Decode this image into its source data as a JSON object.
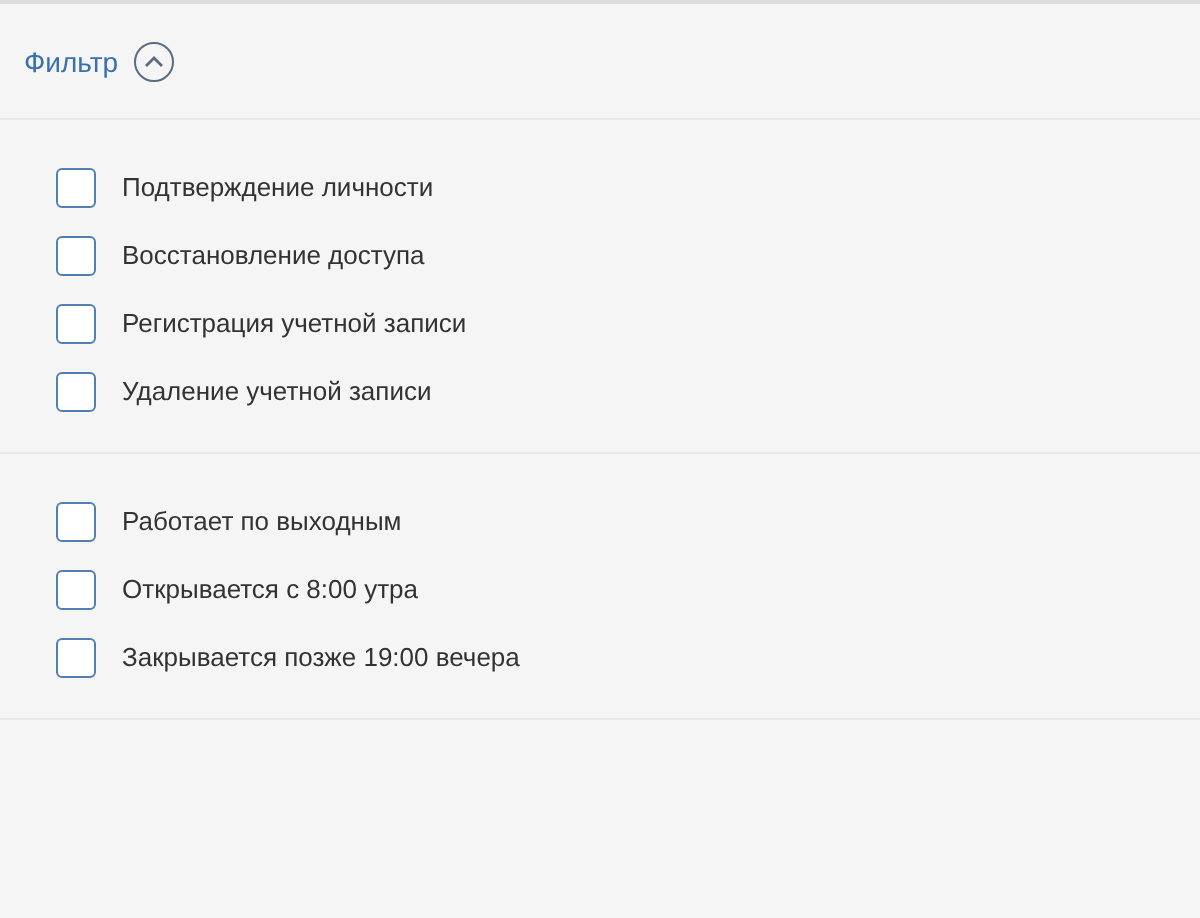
{
  "filter": {
    "title": "Фильтр",
    "expanded": true
  },
  "groups": [
    {
      "options": [
        {
          "label": "Подтверждение личности",
          "checked": false
        },
        {
          "label": "Восстановление доступа",
          "checked": false
        },
        {
          "label": "Регистрация учетной записи",
          "checked": false
        },
        {
          "label": "Удаление учетной записи",
          "checked": false
        }
      ]
    },
    {
      "options": [
        {
          "label": "Работает по выходным",
          "checked": false
        },
        {
          "label": "Открывается с 8:00 утра",
          "checked": false
        },
        {
          "label": "Закрывается позже 19:00 вечера",
          "checked": false
        }
      ]
    }
  ]
}
